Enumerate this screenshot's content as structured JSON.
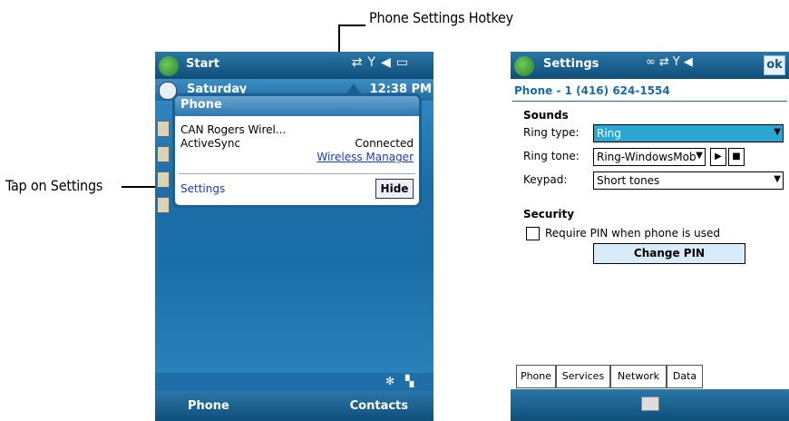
{
  "annotations": {
    "hotkey_label": "Phone Settings Hotkey",
    "settings_label": "Tap on Settings"
  },
  "left_screen": {
    "start_label": "Start",
    "day": "Saturday",
    "time": "12:38 PM",
    "bubble": {
      "title": "Phone",
      "carrier": "CAN Rogers Wirel...",
      "activesync_label": "ActiveSync",
      "activesync_status": "Connected",
      "wireless_manager_link": "Wireless Manager",
      "settings_link": "Settings",
      "hide_button": "Hide"
    },
    "softkeys": {
      "left": "Phone",
      "right": "Contacts"
    },
    "icons": [
      "start-flag-icon",
      "sync-icon",
      "signal-icon",
      "speaker-icon",
      "battery-icon",
      "clock-icon",
      "network-icon",
      "connection-icon"
    ]
  },
  "right_screen": {
    "title": "Settings",
    "ok_button": "ok",
    "phone_number": "Phone - 1 (416) 624-1554",
    "sounds_heading": "Sounds",
    "ring_type_label": "Ring type:",
    "ring_type_value": "Ring",
    "ring_tone_label": "Ring tone:",
    "ring_tone_value": "Ring-WindowsMobil",
    "keypad_label": "Keypad:",
    "keypad_value": "Short tones",
    "security_heading": "Security",
    "require_pin_label": "Require PIN when phone is used",
    "change_pin_button": "Change PIN",
    "tabs": [
      "Phone",
      "Services",
      "Network",
      "Data"
    ],
    "accent_color": "#2aa6d1"
  }
}
